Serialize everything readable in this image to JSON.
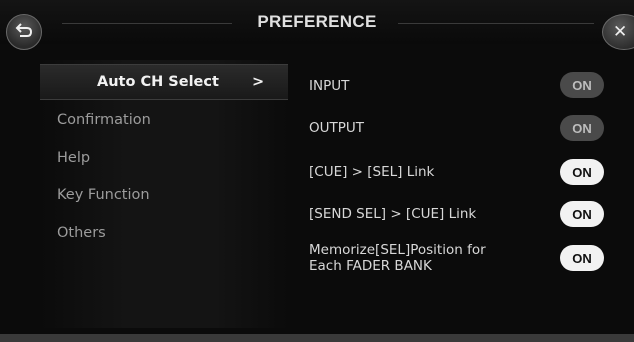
{
  "header": {
    "title": "PREFERENCE",
    "back_icon": "return-arrow-icon",
    "close_icon": "close-icon",
    "close_glyph": "✕"
  },
  "sidebar": {
    "items": [
      {
        "label": "Auto CH Select",
        "selected": true,
        "arrow": ">"
      },
      {
        "label": "Confirmation",
        "selected": false
      },
      {
        "label": "Help",
        "selected": false
      },
      {
        "label": "Key Function",
        "selected": false
      },
      {
        "label": "Others",
        "selected": false
      }
    ]
  },
  "settings": [
    {
      "label": "INPUT",
      "state": "ON",
      "style": "dim"
    },
    {
      "label": "OUTPUT",
      "state": "ON",
      "style": "dim"
    },
    {
      "label": "[CUE] > [SEL] Link",
      "state": "ON",
      "style": "lit"
    },
    {
      "label": "[SEND SEL] > [CUE] Link",
      "state": "ON",
      "style": "lit"
    },
    {
      "label_line1": "Memorize[SEL]Position for",
      "label_line2": "Each FADER BANK",
      "state": "ON",
      "style": "lit"
    }
  ],
  "colors": {
    "background": "#0b0b0b",
    "toggle_dim": "#4a4a4a",
    "toggle_lit": "#f2f2f2"
  }
}
